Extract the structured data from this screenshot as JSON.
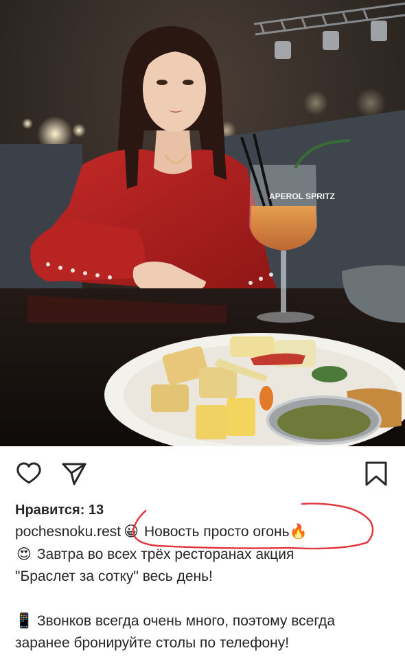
{
  "post": {
    "photo_alt": "Фото из ресторана",
    "likes_text": "Нравится: 13",
    "username": "pochesnoku.rest",
    "caption_lines": {
      "line1": "Новость просто огонь",
      "line2": "Завтра во всех трёх ресторанах акция",
      "line3": "\"Браслет за сотку\" весь день!",
      "line4": "Звонков всегда очень много, поэтому всегда",
      "line5": "заранее бронируйте столы по телефону!"
    },
    "emojis": {
      "grin": "😀",
      "fire": "🔥",
      "heart_eyes": "😍",
      "phone": "📱"
    },
    "glass_text": "APEROL SPRITZ"
  },
  "icons": {
    "like": "heart-icon",
    "share": "paper-plane-icon",
    "save": "bookmark-icon"
  },
  "colors": {
    "text": "#262626",
    "annotation_red": "#e0333a"
  }
}
